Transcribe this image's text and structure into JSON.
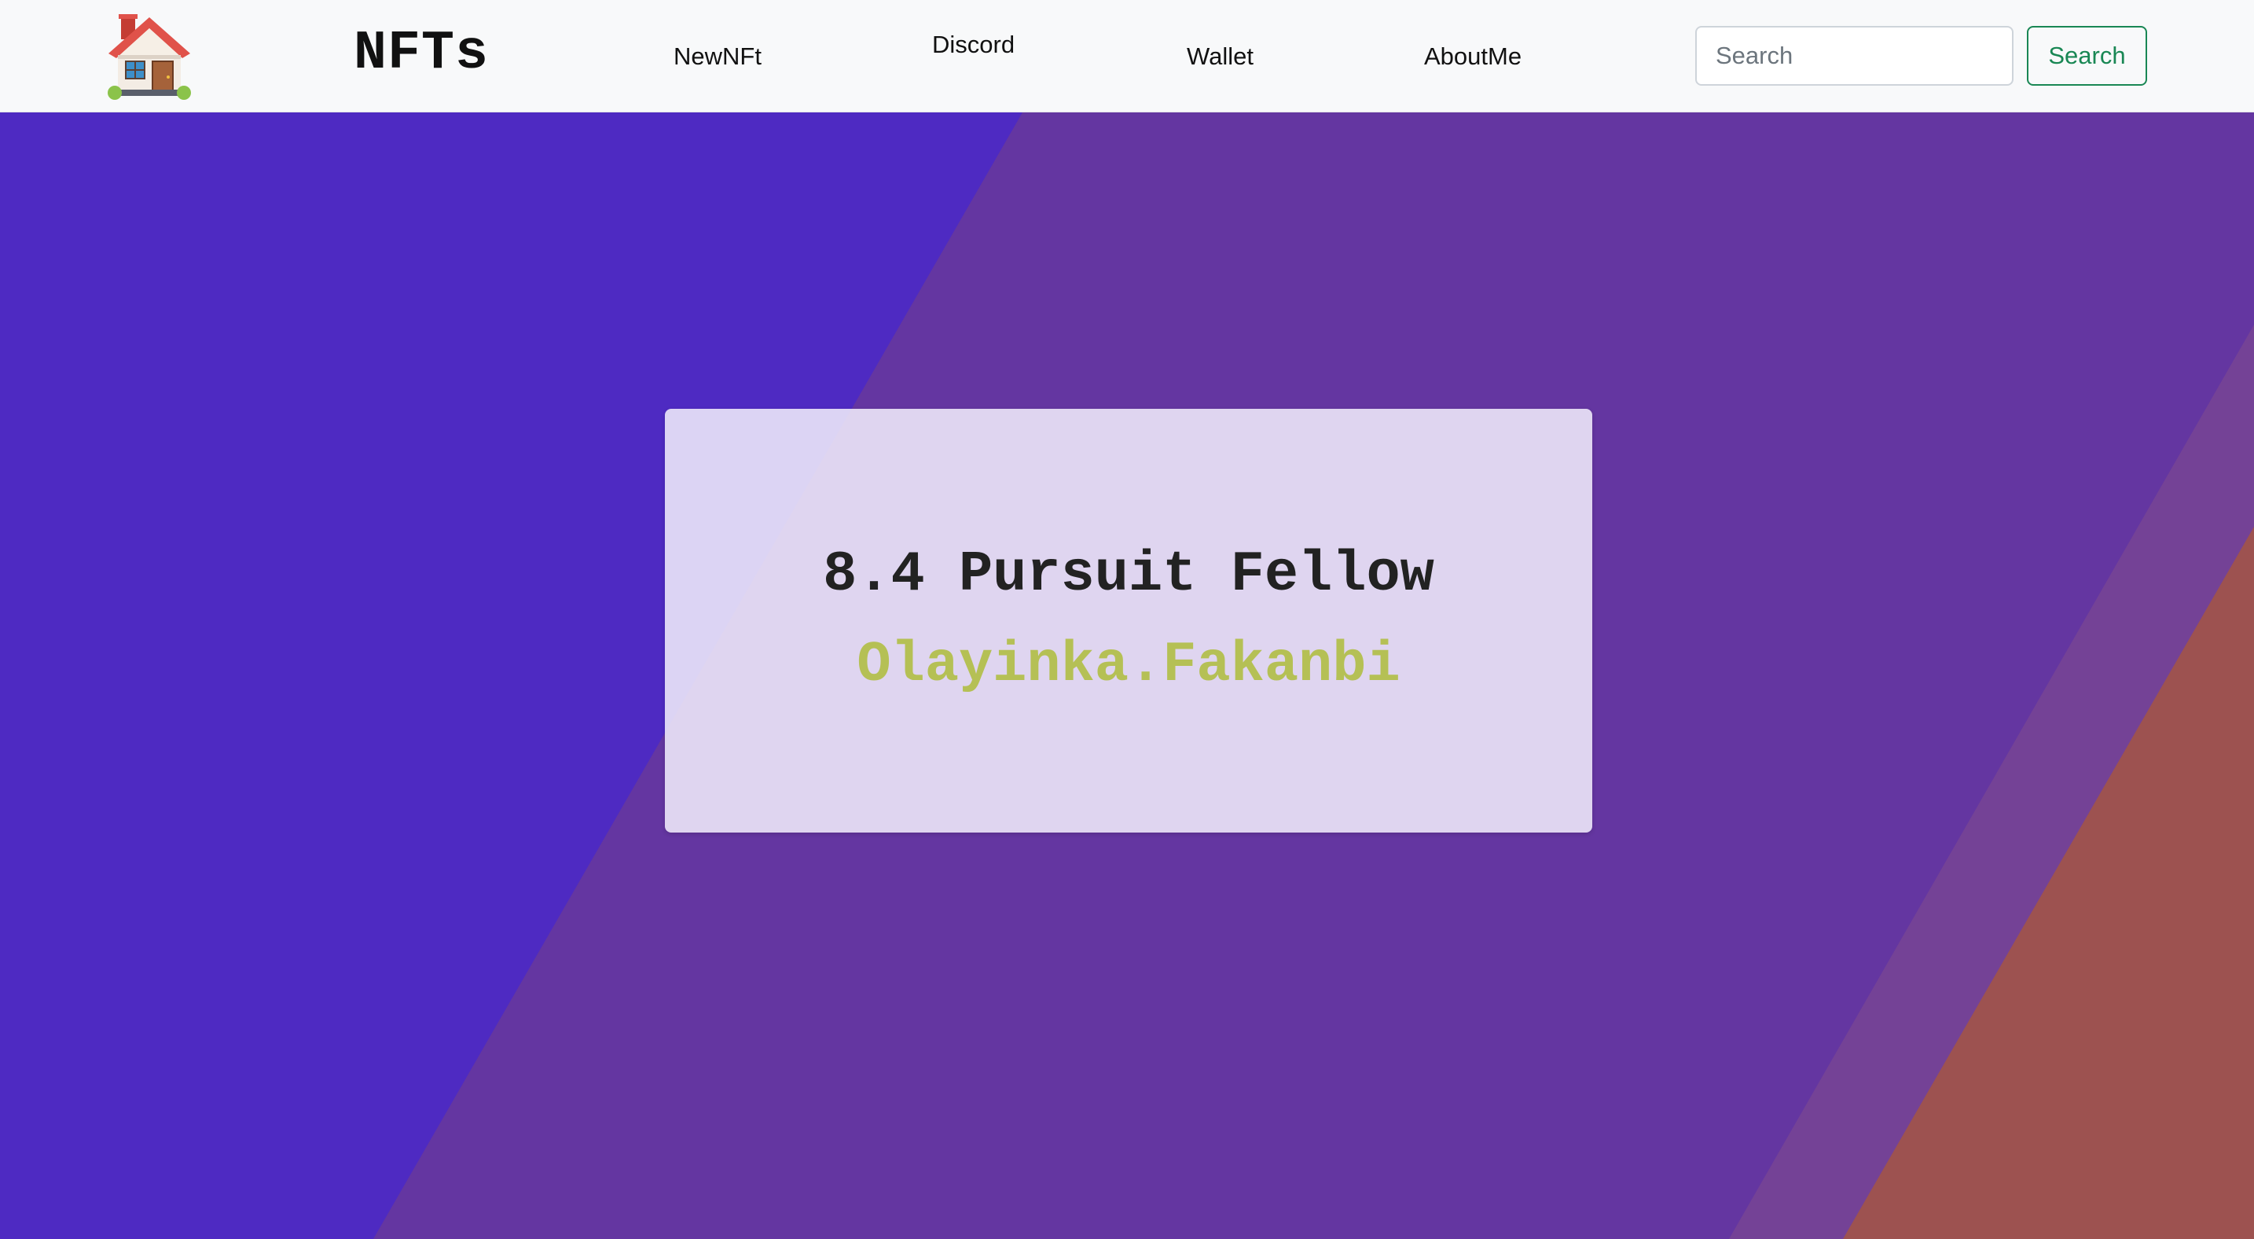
{
  "navbar": {
    "home_icon": "house-emoji-icon",
    "brand": "NFTs",
    "links": {
      "newnft": "NewNFt",
      "discord": "Discord",
      "wallet": "Wallet",
      "aboutme": "AboutMe"
    },
    "search": {
      "placeholder": "Search",
      "value": "",
      "button_label": "Search"
    }
  },
  "hero": {
    "card": {
      "title": "8.4 Pursuit Fellow",
      "subtitle": "Olayinka.Fakanbi"
    }
  },
  "colors": {
    "navbar_bg": "#f8f9fa",
    "hero_blue": "#4e2ac2",
    "hero_purple": "#6436a1",
    "hero_violet": "#744296",
    "hero_orange": "#9d5250",
    "search_button": "#198754",
    "subtitle": "#b5c055"
  }
}
